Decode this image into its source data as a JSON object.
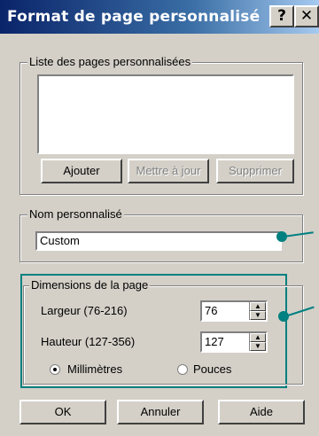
{
  "window": {
    "title": "Format de page personnalisé",
    "help_btn": "?",
    "close_btn": "✕"
  },
  "list_group": {
    "label": "Liste des pages personnalisées",
    "buttons": {
      "add": "Ajouter",
      "update": "Mettre à jour",
      "delete": "Supprimer"
    }
  },
  "name_group": {
    "label": "Nom personnalisé",
    "value": "Custom"
  },
  "dims_group": {
    "label": "Dimensions de la page",
    "width_label": "Largeur (76-216)",
    "width_value": "76",
    "height_label": "Hauteur (127-356)",
    "height_value": "127",
    "unit_mm": "Millimètres",
    "unit_in": "Pouces",
    "selected_unit": "mm"
  },
  "footer": {
    "ok": "OK",
    "cancel": "Annuler",
    "help": "Aide"
  },
  "colors": {
    "highlight": "#008080",
    "titlebar": "#0a246a",
    "face": "#d4d0c8"
  },
  "arrow_up": "▲",
  "arrow_down": "▼"
}
